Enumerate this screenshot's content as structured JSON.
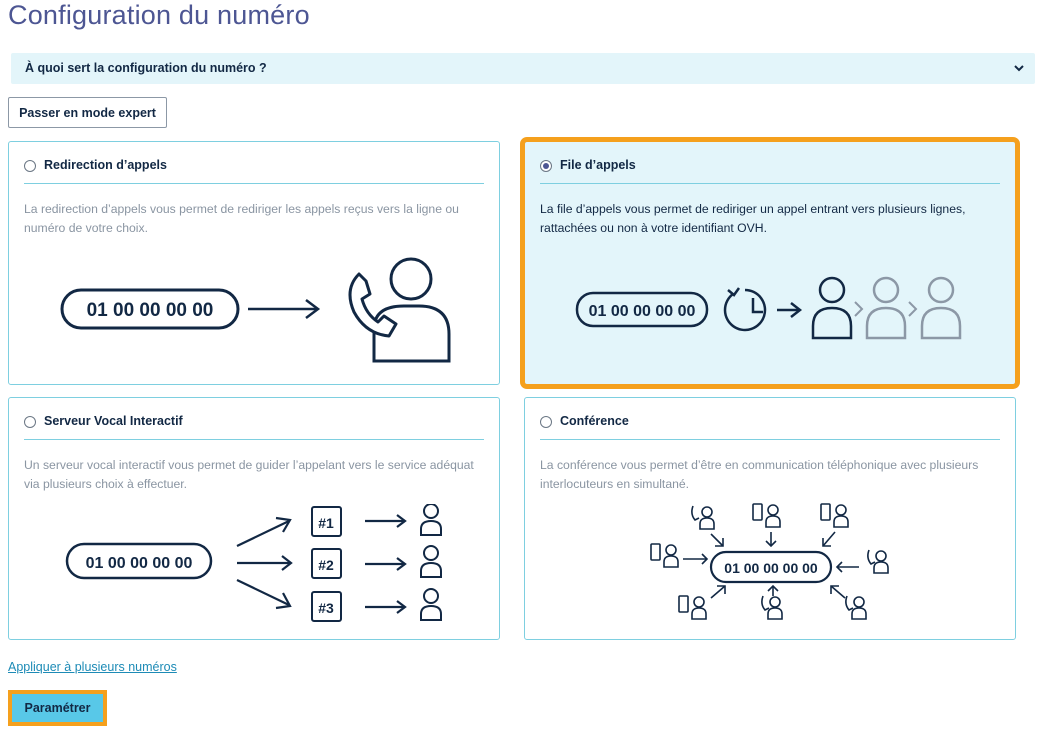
{
  "page": {
    "title": "Configuration du numéro"
  },
  "accordion": {
    "label": "À quoi sert la configuration du numéro ?"
  },
  "expert_button": {
    "label": "Passer en mode expert"
  },
  "cards": [
    {
      "title": "Redirection d’appels",
      "description": "La redirection d’appels vous permet de rediriger les appels reçus vers la ligne ou numéro de votre choix.",
      "selected": false,
      "number": "01 00 00 00 00"
    },
    {
      "title": "File d’appels",
      "description": "La file d’appels vous permet de rediriger un appel entrant vers plusieurs lignes, rattachées ou non à votre identifiant OVH.",
      "selected": true,
      "number": "01 00 00 00 00"
    },
    {
      "title": "Serveur Vocal Interactif",
      "description": "Un serveur vocal interactif vous permet de guider l’appelant vers le service adéquat via plusieurs choix à effectuer.",
      "selected": false,
      "number": "01 00 00 00 00",
      "keys": [
        "#1",
        "#2",
        "#3"
      ]
    },
    {
      "title": "Conférence",
      "description": "La conférence vous permet d’être en communication téléphonique avec plusieurs interlocuteurs en simultané.",
      "selected": false,
      "number": "01 00 00 00 00"
    }
  ],
  "apply_link": {
    "label": "Appliquer à plusieurs numéros"
  },
  "submit_button": {
    "label": "Paramétrer"
  },
  "colors": {
    "accent": "#f5a01d",
    "primary_button": "#58c8e8",
    "selected_bg": "#e3f5fa",
    "card_border": "#7ecfe0",
    "title": "#4d5693"
  }
}
